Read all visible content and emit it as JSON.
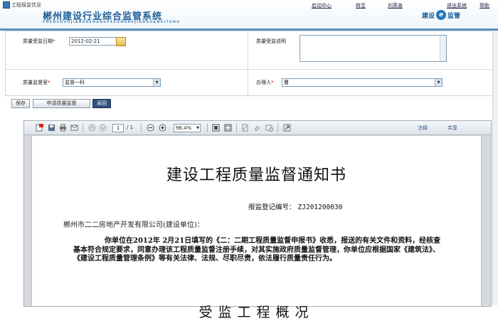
{
  "header": {
    "tag_label": "工程报监信息",
    "app_title": "郴州建设行业综合监管系统",
    "app_subtitle": "CHENZHOUJIANSHEHANGYEZONGHEJIANGUANXITONG",
    "nav": [
      "启动中心",
      "转至",
      "刘英善",
      "退出系统",
      "帮助"
    ],
    "brand_left": "建设",
    "brand_e": "e",
    "brand_right": "监管"
  },
  "form": {
    "date_label": "质量受监日期",
    "date_value": "2012-02-21",
    "desc_label": "质量受监说明",
    "office_label": "质量监督室",
    "office_value": "监督一科",
    "handler_label": "办理人",
    "handler_value": "曹",
    "required_mark": "*"
  },
  "buttons": {
    "save": "保存",
    "apply": "申请质量监督",
    "back": "返回"
  },
  "viewer": {
    "page_current": "1",
    "page_total": "/ 1",
    "zoom": "96.4%",
    "annotate": "注释",
    "share": "共享"
  },
  "document": {
    "title": "建设工程质量监督通知书",
    "reg_label": "报监登记编号：",
    "reg_no": "ZJ201200030",
    "unit_line": "郴州市二二房地产开发有限公司(建设单位)：",
    "paragraph": "你单位在2012年 2月21日填写的《二：二期工程质量监督申报书》收悉，报送的有关文件和资料，经核查基本符合规定要求，同意办理该工程质量监督注册手续，对其实施政府质量监督管理，你单位应根据国家《建筑法》、《建设工程质量管理条例》等有关法律、法规、尽职尽责，依法履行质量责任行为。",
    "section_title": "受监工程概况"
  },
  "colors": {
    "header_blue": "#1d5e98",
    "toolbar_bar": "#5f8fbf",
    "back_button": "#2f4f7d"
  }
}
